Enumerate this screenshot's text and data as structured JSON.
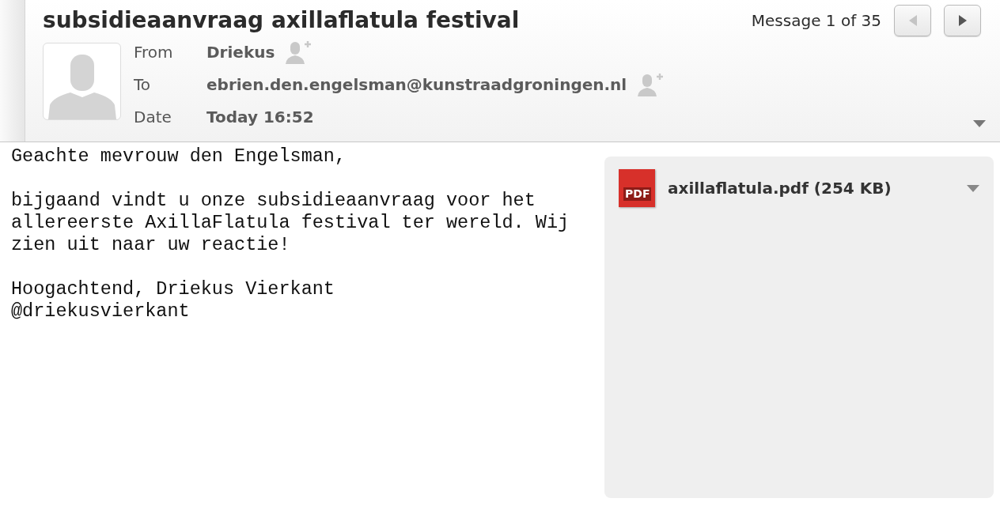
{
  "message": {
    "subject": "subsidieaanvraag axillaflatula festival",
    "counter": "Message 1 of 35",
    "nav": [
      {
        "kind": "prev",
        "disabled": true
      },
      {
        "kind": "next",
        "disabled": false
      }
    ],
    "fields": [
      {
        "label": "From",
        "value": "Driekus",
        "add_contact": true
      },
      {
        "label": "To",
        "value": "ebrien.den.engelsman@kunstraadgroningen.nl",
        "add_contact": true
      },
      {
        "label": "Date",
        "value": "Today 16:52",
        "add_contact": false
      }
    ],
    "body": [
      "Geachte mevrouw den Engelsman,",
      "bijgaand vindt u onze subsidieaanvraag voor het\nallereerste AxillaFlatula festival ter wereld. Wij\nzien uit naar uw reactie!",
      "Hoogachtend, Driekus Vierkant\n@driekusvierkant"
    ],
    "attachments": [
      {
        "icon_text": "PDF",
        "name": "axillaflatula.pdf (254 KB)"
      }
    ]
  }
}
